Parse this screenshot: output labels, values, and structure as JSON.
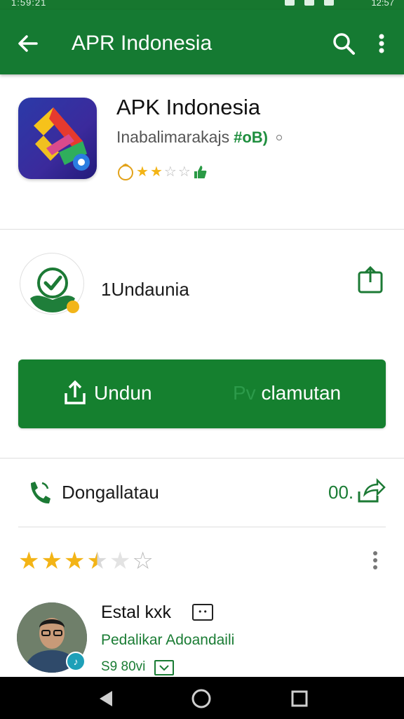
{
  "status_bar": {
    "time_left": "1:59:21",
    "time_right": "12:57"
  },
  "app_bar": {
    "title": "APR Indonesia",
    "back_icon": "arrow-back-icon",
    "search_icon": "search-icon",
    "more_icon": "more-vert-icon"
  },
  "app": {
    "name": "APK Indonesia",
    "developer": "Inabalimarakajs",
    "developer_badge": "#oB)",
    "rating_stars_filled": 2,
    "rating_stars_total": 5
  },
  "verify": {
    "label": "1Undaunia",
    "share_icon": "share-icon"
  },
  "primary_button": {
    "download_label": "Undun",
    "secondary_prefix": "Pv",
    "secondary_label": "clamutan"
  },
  "contact": {
    "label": "Dongallatau",
    "count": "00."
  },
  "review": {
    "stars_filled": 3.5,
    "stars_total": 5,
    "reviewer_name": "Estal kxk",
    "reviewer_subtitle": "Pedalikar Adoandaili",
    "date": "S9 80vi"
  },
  "colors": {
    "primary": "#157a32",
    "accent": "#1a7c34",
    "star": "#f3b416"
  }
}
